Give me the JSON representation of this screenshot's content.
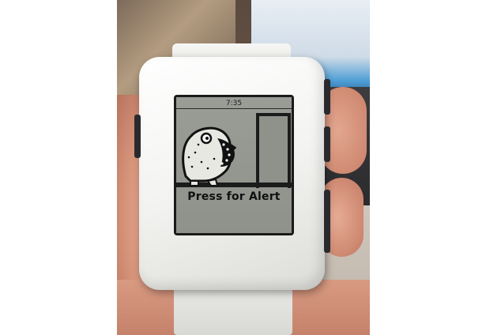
{
  "watch": {
    "time": "7:35",
    "message": "Press for Alert"
  },
  "icons": {
    "illustration": "monster-icon"
  },
  "colors": {
    "watch_body": "#f3f3f1",
    "screen_bg": "#9a9c96",
    "screen_ink": "#111111"
  }
}
